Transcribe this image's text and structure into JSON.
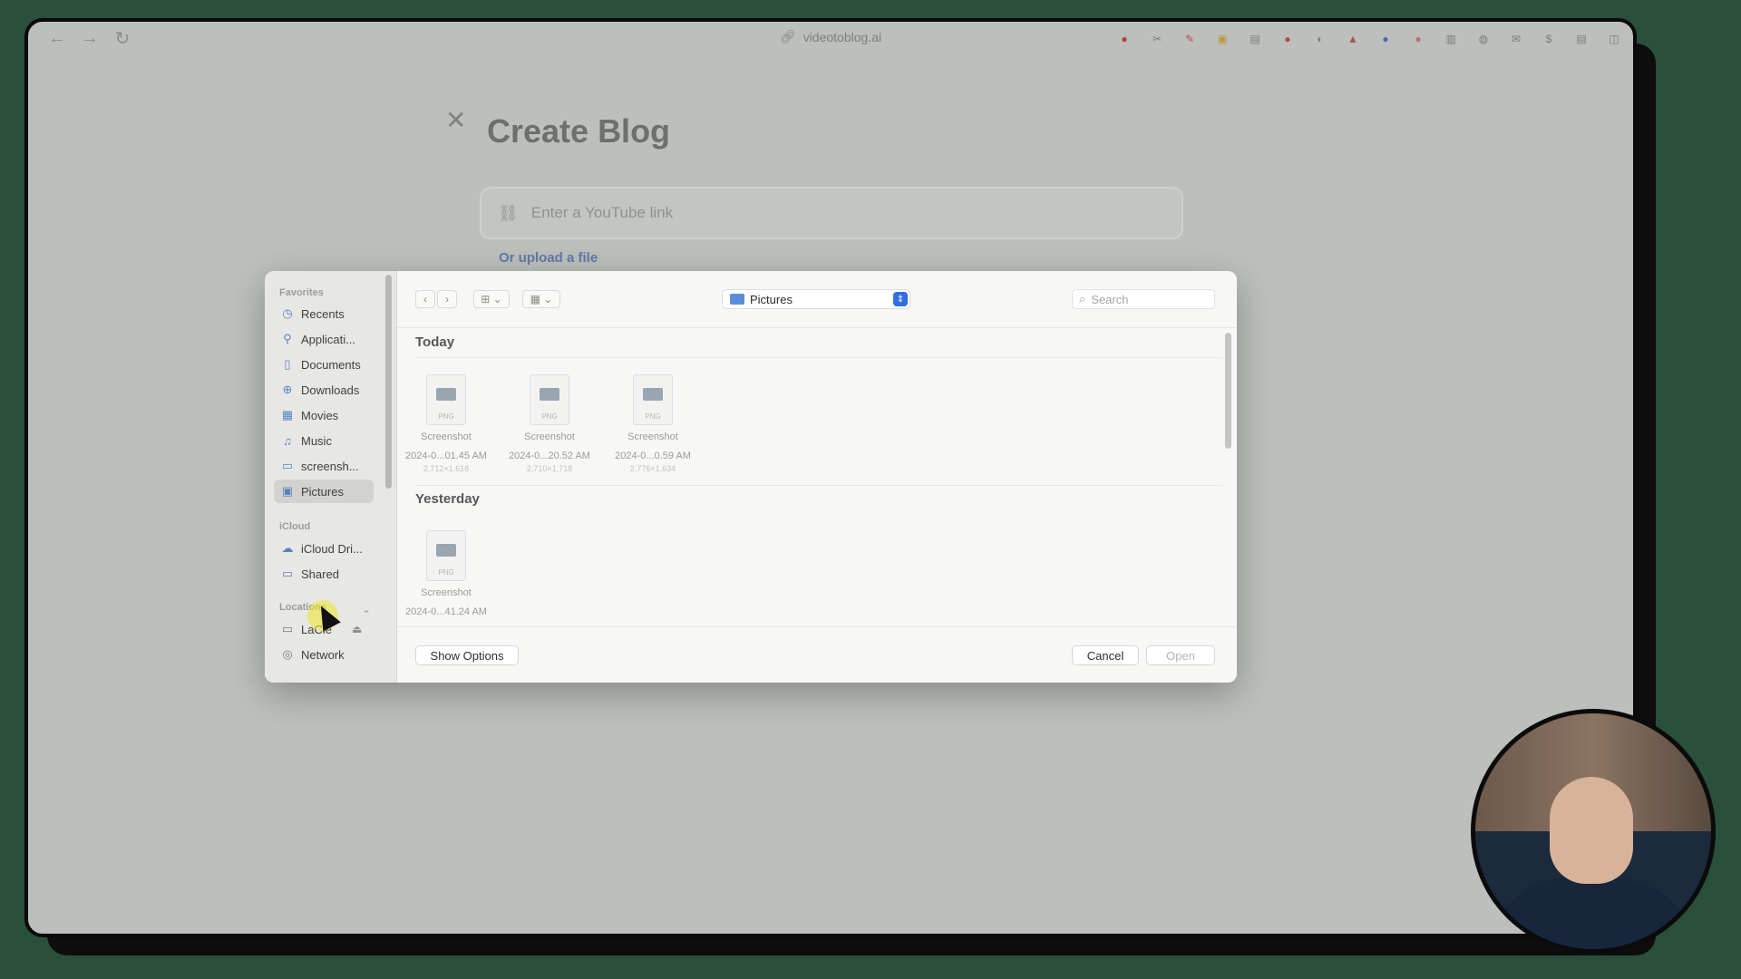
{
  "browser": {
    "url": "videotoblog.ai"
  },
  "page": {
    "title": "Create Blog",
    "youtube_placeholder": "Enter a YouTube link",
    "upload_link": "Or upload a file"
  },
  "dialog": {
    "sidebar": {
      "favorites_label": "Favorites",
      "favorites": [
        {
          "label": "Recents",
          "icon": "clock-icon"
        },
        {
          "label": "Applicati...",
          "icon": "applications-icon"
        },
        {
          "label": "Documents",
          "icon": "document-icon"
        },
        {
          "label": "Downloads",
          "icon": "download-icon"
        },
        {
          "label": "Movies",
          "icon": "film-icon"
        },
        {
          "label": "Music",
          "icon": "music-icon"
        },
        {
          "label": "screensh...",
          "icon": "folder-icon"
        },
        {
          "label": "Pictures",
          "icon": "pictures-icon",
          "selected": true
        }
      ],
      "icloud_label": "iCloud",
      "icloud": [
        {
          "label": "iCloud Dri...",
          "icon": "cloud-icon"
        },
        {
          "label": "Shared",
          "icon": "shared-folder-icon"
        }
      ],
      "locations_label": "Locations",
      "locations": [
        {
          "label": "LaCie",
          "icon": "drive-icon"
        },
        {
          "label": "Network",
          "icon": "network-icon"
        }
      ]
    },
    "location": "Pictures",
    "search_placeholder": "Search",
    "groups": [
      {
        "title": "Today",
        "files": [
          {
            "name": "Screenshot",
            "date": "2024-0...01.45 AM",
            "dim": "2,712×1,618"
          },
          {
            "name": "Screenshot",
            "date": "2024-0...20.52 AM",
            "dim": "2,710×1,718"
          },
          {
            "name": "Screenshot",
            "date": "2024-0...0.59 AM",
            "dim": "2,776×1,634"
          }
        ]
      },
      {
        "title": "Yesterday",
        "files": [
          {
            "name": "Screenshot",
            "date": "2024-0...41.24 AM",
            "dim": ""
          }
        ]
      }
    ],
    "show_options": "Show Options",
    "cancel": "Cancel",
    "open": "Open"
  }
}
